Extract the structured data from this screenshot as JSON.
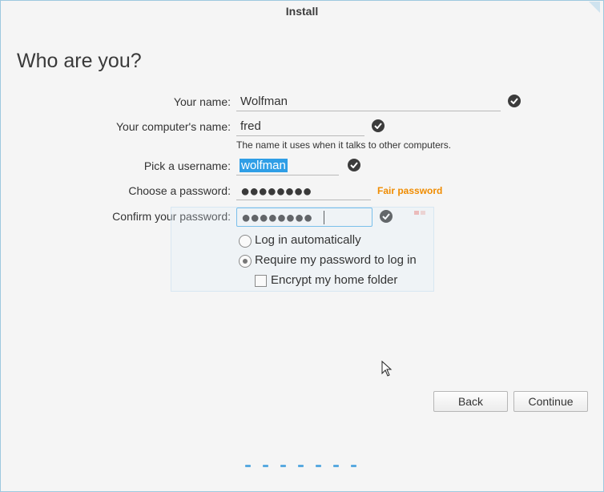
{
  "window": {
    "title": "Install"
  },
  "page": {
    "heading": "Who are you?"
  },
  "form": {
    "name": {
      "label": "Your name:",
      "value": "Wolfman"
    },
    "computer": {
      "label": "Your computer's name:",
      "value": "fred",
      "hint": "The name it uses when it talks to other computers."
    },
    "username": {
      "label": "Pick a username:",
      "value": "wolfman"
    },
    "password": {
      "label": "Choose a password:",
      "masked": "●●●●●●●●",
      "strength": "Fair password"
    },
    "confirm": {
      "label": "Confirm your password:",
      "masked": "●●●●●●●●"
    }
  },
  "options": {
    "auto_login": {
      "label": "Log in automatically",
      "selected": false
    },
    "require_password": {
      "label": "Require my password to log in",
      "selected": true
    },
    "encrypt_home": {
      "label": "Encrypt my home folder",
      "checked": false
    }
  },
  "buttons": {
    "back": "Back",
    "continue": "Continue"
  },
  "progress": {
    "steps": 7
  },
  "colors": {
    "accent": "#2f9ee6",
    "strength": "#f08c00",
    "check": "#3c3c3c"
  }
}
